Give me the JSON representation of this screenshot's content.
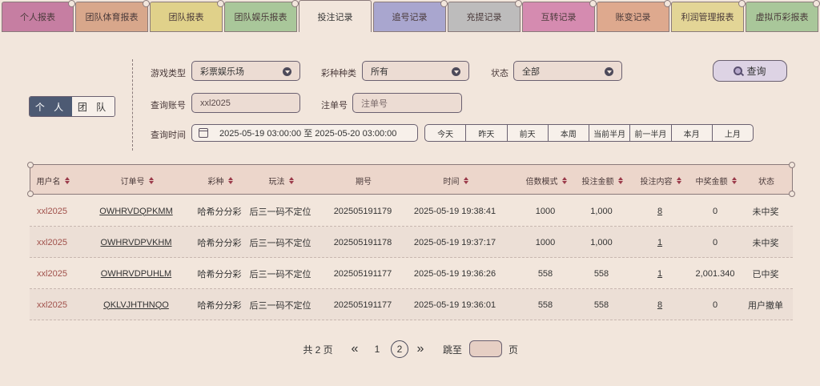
{
  "tabs": [
    {
      "label": "个人报表",
      "color": "#c67ea2"
    },
    {
      "label": "团队体育报表",
      "color": "#d8a78b"
    },
    {
      "label": "团队报表",
      "color": "#e0d18a"
    },
    {
      "label": "团队娱乐报表",
      "color": "#a9c79a"
    },
    {
      "label": "投注记录",
      "color": "#f2e6dc"
    },
    {
      "label": "追号记录",
      "color": "#a9a6cf"
    },
    {
      "label": "充提记录",
      "color": "#bdbcbc"
    },
    {
      "label": "互转记录",
      "color": "#d58bb0"
    },
    {
      "label": "账变记录",
      "color": "#dea98e"
    },
    {
      "label": "利润管理报表",
      "color": "#e3d596"
    },
    {
      "label": "虚拟币彩报表",
      "color": "#a9c79a"
    }
  ],
  "scope": {
    "personal": "个 人",
    "team": "团 队"
  },
  "filters": {
    "game_type_label": "游戏类型",
    "game_type_value": "彩票娱乐场",
    "lottery_kind_label": "彩种种类",
    "lottery_kind_value": "所有",
    "status_label": "状态",
    "status_value": "全部",
    "account_label": "查询账号",
    "account_value": "xxl2025",
    "order_label": "注单号",
    "order_placeholder": "注单号",
    "time_label": "查询时间",
    "time_range": "2025-05-19 03:00:00 至 2025-05-20 03:00:00",
    "quick_ranges": [
      "今天",
      "昨天",
      "前天",
      "本周",
      "当前半月",
      "前一半月",
      "本月",
      "上月"
    ],
    "search_label": "查询"
  },
  "table": {
    "headers": [
      "用户名",
      "订单号",
      "彩种",
      "玩法",
      "期号",
      "时间",
      "倍数模式",
      "投注金额",
      "投注内容",
      "中奖金额",
      "状态"
    ],
    "sortable": [
      true,
      true,
      true,
      true,
      false,
      true,
      true,
      true,
      true,
      true,
      false
    ],
    "rows": [
      [
        "xxl2025",
        "OWHRVDQPKMM",
        "哈希分分彩",
        "后三一码不定位",
        "202505191179",
        "2025-05-19 19:38:41",
        "1000",
        "1,000",
        "8",
        "0",
        "未中奖"
      ],
      [
        "xxl2025",
        "OWHRVDPVKHM",
        "哈希分分彩",
        "后三一码不定位",
        "202505191178",
        "2025-05-19 19:37:17",
        "1000",
        "1,000",
        "1",
        "0",
        "未中奖"
      ],
      [
        "xxl2025",
        "OWHRVDPUHLM",
        "哈希分分彩",
        "后三一码不定位",
        "202505191177",
        "2025-05-19 19:36:26",
        "558",
        "558",
        "1",
        "2,001.340",
        "已中奖"
      ],
      [
        "xxl2025",
        "QKLVJHTHNQO",
        "哈希分分彩",
        "后三一码不定位",
        "202505191177",
        "2025-05-19 19:36:01",
        "558",
        "558",
        "8",
        "0",
        "用户撤单"
      ]
    ]
  },
  "pagination": {
    "total": "共 2 页",
    "first": "«",
    "page1": "1",
    "page2": "2",
    "next": "»",
    "jump_label": "跳至",
    "page_unit": "页"
  }
}
